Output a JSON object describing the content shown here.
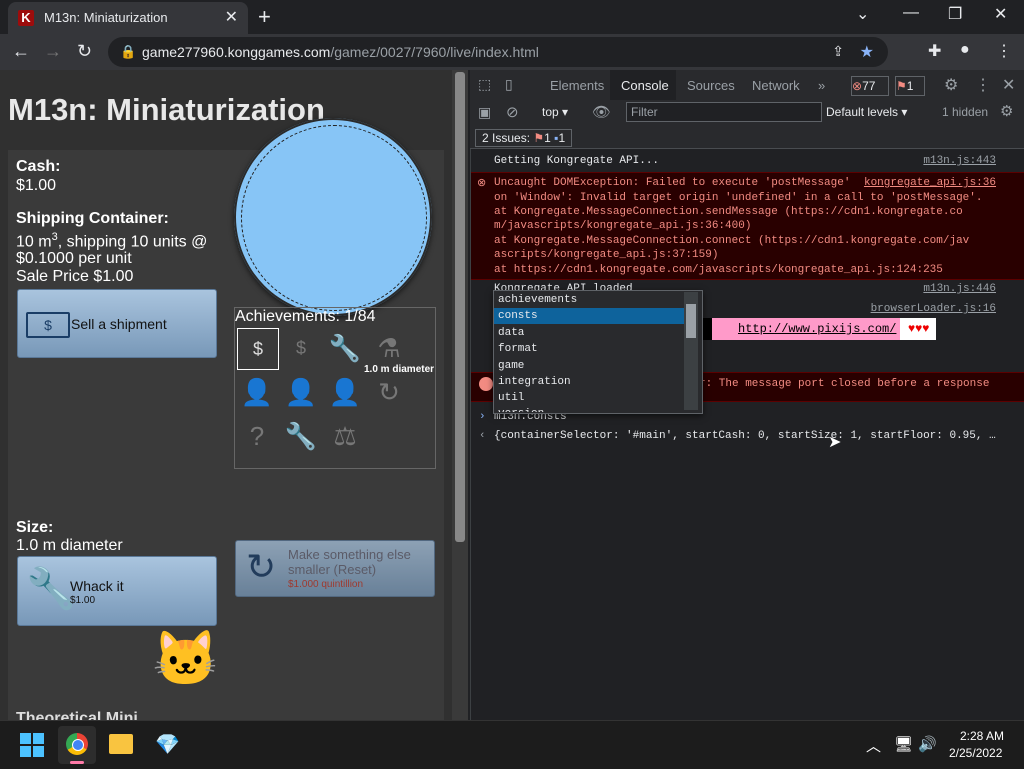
{
  "browser": {
    "tab_title": "M13n: Miniaturization",
    "tab_favicon": "K",
    "url_host": "game277960.konggames.com",
    "url_path": "/gamez/0027/7960/live/index.html"
  },
  "game": {
    "title": "M13n: Miniaturization",
    "cash_label": "Cash:",
    "cash_value": "$1.00",
    "shipping_label": "Shipping Container:",
    "shipping_line1_a": "10 m",
    "shipping_line1_sup": "3",
    "shipping_line1_b": ", shipping 10 units @",
    "shipping_line2": "$0.1000 per unit",
    "shipping_line3": "Sale Price $1.00",
    "sell_button": "Sell a shipment",
    "diameter_caption": "1.0 m diameter",
    "achievements_label": "Achievements: 1/84",
    "size_label": "Size:",
    "size_value": "1.0 m diameter",
    "whack_button": "Whack it",
    "whack_price": "$1.00",
    "reset_button": "Make something else smaller (Reset)",
    "reset_price": "$1.000 quintillion",
    "bottom_cut_label": "Theoretical Mini..."
  },
  "devtools": {
    "tabs": [
      "Elements",
      "Console",
      "Sources",
      "Network"
    ],
    "error_count": "77",
    "issue_count": "1",
    "context": "top",
    "filter_placeholder": "Filter",
    "levels": "Default levels",
    "hidden": "1 hidden",
    "issues_label": "2 Issues:",
    "issues_err": "1",
    "issues_info": "1",
    "logs": {
      "getting_api": "Getting Kongregate API...",
      "getting_api_src": "m13n.js:443",
      "err1_line1": "Uncaught DOMException: Failed to execute 'postMessage'",
      "err1_src": "kongregate_api.js:36",
      "err1_line2": "on 'Window': Invalid target origin 'undefined' in a call to 'postMessage'.",
      "err1_line3": "    at Kongregate.MessageConnection.sendMessage (https://cdn1.kongregate.co",
      "err1_line4": "m/javascripts/kongregate_api.js:36:400)",
      "err1_line5": "    at Kongregate.MessageConnection.connect (https://cdn1.kongregate.com/jav",
      "err1_line6": "ascripts/kongregate_api.js:37:159)",
      "err1_line7": "    at https://cdn1.kongregate.com/javascripts/kongregate_api.js:124:235",
      "api_loaded": "Kongregate API loaded",
      "api_loaded_src": "m13n.js:446",
      "browser_loader_src": "browserLoader.js:16",
      "pixi_link": "http://www.pixijs.com/",
      "pixi_hearts": "♥♥♥",
      "err2_tail": "r: The message port closed before a response",
      "input_cmd": "m13n.consts",
      "result": "{containerSelector: '#main', startCash: 0, startSize: 1, startFloor: 0.95, …"
    },
    "autocomplete": [
      "achievements",
      "consts",
      "data",
      "format",
      "game",
      "integration",
      "util",
      "version"
    ],
    "autocomplete_selected": "consts"
  },
  "taskbar": {
    "time": "2:28 AM",
    "date": "2/25/2022"
  }
}
